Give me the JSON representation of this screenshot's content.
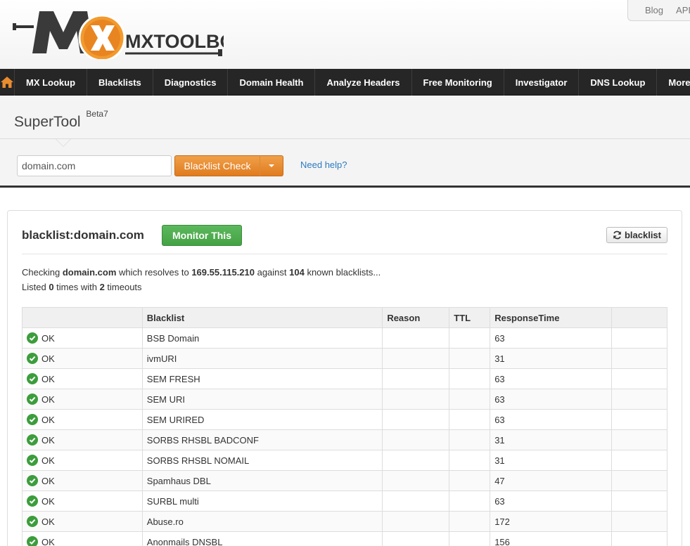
{
  "header": {
    "logo_text": "MXTOOLBOX",
    "top_links": [
      "Blog",
      "API"
    ]
  },
  "nav": {
    "items": [
      "MX Lookup",
      "Blacklists",
      "Diagnostics",
      "Domain Health",
      "Analyze Headers",
      "Free Monitoring",
      "Investigator",
      "DNS Lookup",
      "More"
    ]
  },
  "supertool": {
    "title": "SuperTool",
    "version": "Beta7",
    "input_value": "domain.com",
    "button_label": "Blacklist Check",
    "help_link": "Need help?"
  },
  "result": {
    "title": "blacklist:domain.com",
    "monitor_label": "Monitor This",
    "refresh_label": "blacklist",
    "summary": {
      "p1": "Checking ",
      "domain": "domain.com",
      "p2": " which resolves to ",
      "ip": "169.55.115.210",
      "p3": " against ",
      "count": "104",
      "p4": " known blacklists...",
      "p5": "Listed ",
      "listed": "0",
      "p6": " times with ",
      "timeouts": "2",
      "p7": " timeouts"
    },
    "columns": [
      "",
      "Blacklist",
      "Reason",
      "TTL",
      "ResponseTime",
      ""
    ],
    "rows": [
      {
        "status": "OK",
        "blacklist": "BSB Domain",
        "reason": "",
        "ttl": "",
        "response": "63"
      },
      {
        "status": "OK",
        "blacklist": "ivmURI",
        "reason": "",
        "ttl": "",
        "response": "31"
      },
      {
        "status": "OK",
        "blacklist": "SEM FRESH",
        "reason": "",
        "ttl": "",
        "response": "63"
      },
      {
        "status": "OK",
        "blacklist": "SEM URI",
        "reason": "",
        "ttl": "",
        "response": "63"
      },
      {
        "status": "OK",
        "blacklist": "SEM URIRED",
        "reason": "",
        "ttl": "",
        "response": "63"
      },
      {
        "status": "OK",
        "blacklist": "SORBS RHSBL BADCONF",
        "reason": "",
        "ttl": "",
        "response": "31"
      },
      {
        "status": "OK",
        "blacklist": "SORBS RHSBL NOMAIL",
        "reason": "",
        "ttl": "",
        "response": "31"
      },
      {
        "status": "OK",
        "blacklist": "Spamhaus DBL",
        "reason": "",
        "ttl": "",
        "response": "47"
      },
      {
        "status": "OK",
        "blacklist": "SURBL multi",
        "reason": "",
        "ttl": "",
        "response": "63"
      },
      {
        "status": "OK",
        "blacklist": "Abuse.ro",
        "reason": "",
        "ttl": "",
        "response": "172"
      },
      {
        "status": "OK",
        "blacklist": "Anonmails DNSBL",
        "reason": "",
        "ttl": "",
        "response": "156"
      }
    ]
  },
  "colors": {
    "nav_bg": "#262626",
    "orange": "#e98c2e",
    "green": "#4cae4c",
    "link": "#2a7bc1"
  }
}
